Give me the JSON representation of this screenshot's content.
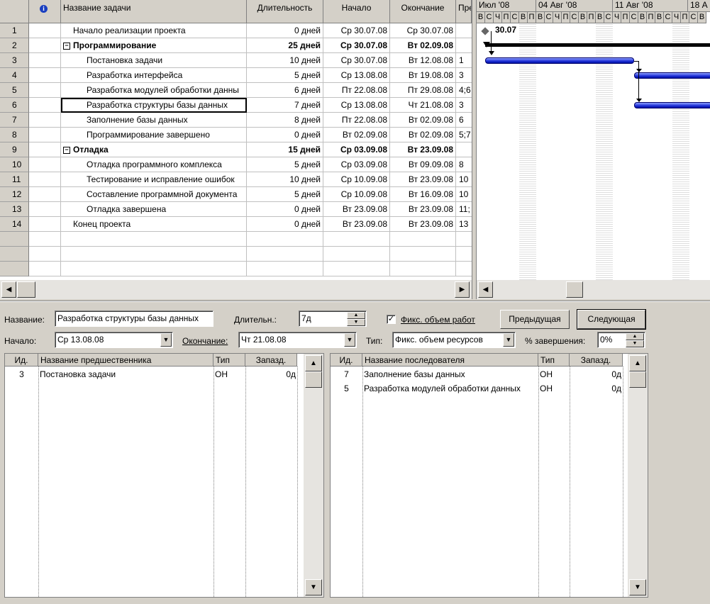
{
  "columns": {
    "info": "i",
    "name": "Название задачи",
    "duration": "Длительность",
    "start": "Начало",
    "finish": "Окончание",
    "pred": "Пре"
  },
  "tasks": [
    {
      "id": "1",
      "name": "Начало реализации проекта",
      "duration": "0 дней",
      "start": "Ср 30.07.08",
      "finish": "Ср 30.07.08",
      "pred": ""
    },
    {
      "id": "2",
      "name": "Программирование",
      "duration": "25 дней",
      "start": "Ср 30.07.08",
      "finish": "Вт 02.09.08",
      "pred": ""
    },
    {
      "id": "3",
      "name": "Постановка задачи",
      "duration": "10 дней",
      "start": "Ср 30.07.08",
      "finish": "Вт 12.08.08",
      "pred": "1"
    },
    {
      "id": "4",
      "name": "Разработка интерфейса",
      "duration": "5 дней",
      "start": "Ср 13.08.08",
      "finish": "Вт 19.08.08",
      "pred": "3"
    },
    {
      "id": "5",
      "name": "Разработка модулей обработки данны",
      "duration": "6 дней",
      "start": "Пт 22.08.08",
      "finish": "Пт 29.08.08",
      "pred": "4;6"
    },
    {
      "id": "6",
      "name": "Разработка структуры базы данных",
      "duration": "7 дней",
      "start": "Ср 13.08.08",
      "finish": "Чт 21.08.08",
      "pred": "3"
    },
    {
      "id": "7",
      "name": "Заполнение базы данных",
      "duration": "8 дней",
      "start": "Пт 22.08.08",
      "finish": "Вт 02.09.08",
      "pred": "6"
    },
    {
      "id": "8",
      "name": "Программирование завершено",
      "duration": "0 дней",
      "start": "Вт 02.09.08",
      "finish": "Вт 02.09.08",
      "pred": "5;7"
    },
    {
      "id": "9",
      "name": "Отладка",
      "duration": "15 дней",
      "start": "Ср 03.09.08",
      "finish": "Вт 23.09.08",
      "pred": ""
    },
    {
      "id": "10",
      "name": "Отладка программного комплекса",
      "duration": "5 дней",
      "start": "Ср 03.09.08",
      "finish": "Вт 09.09.08",
      "pred": "8"
    },
    {
      "id": "11",
      "name": "Тестирование и исправление ошибок",
      "duration": "10 дней",
      "start": "Ср 10.09.08",
      "finish": "Вт 23.09.08",
      "pred": "10"
    },
    {
      "id": "12",
      "name": "Составление программной документа",
      "duration": "5 дней",
      "start": "Ср 10.09.08",
      "finish": "Вт 16.09.08",
      "pred": "10"
    },
    {
      "id": "13",
      "name": "Отладка завершена",
      "duration": "0 дней",
      "start": "Вт 23.09.08",
      "finish": "Вт 23.09.08",
      "pred": "11;"
    },
    {
      "id": "14",
      "name": "Конец проекта",
      "duration": "0 дней",
      "start": "Вт 23.09.08",
      "finish": "Вт 23.09.08",
      "pred": "13"
    }
  ],
  "gantt": {
    "weeks": [
      "Июл '08",
      "04 Авг '08",
      "11 Авг '08",
      "18 А"
    ],
    "days": [
      "В",
      "С",
      "Ч",
      "П",
      "С",
      "В",
      "П",
      "В",
      "С",
      "Ч",
      "П",
      "С",
      "В",
      "П",
      "В",
      "С",
      "Ч",
      "П",
      "С",
      "В",
      "П",
      "В",
      "С",
      "Ч",
      "П",
      "С",
      "В"
    ],
    "milestone_label": "30.07"
  },
  "form": {
    "name_label": "Название:",
    "name_value": "Разработка структуры базы данных",
    "duration_label": "Длительн.:",
    "duration_value": "7д",
    "fixed_work_label": "Фикс. объем работ",
    "prev_button": "Предыдущая",
    "next_button": "Следующая",
    "start_label": "Начало:",
    "start_value": "Ср 13.08.08",
    "finish_label": "Окончание:",
    "finish_value": "Чт 21.08.08",
    "type_label": "Тип:",
    "type_value": "Фикс. объем ресурсов",
    "complete_label": "% завершения:",
    "complete_value": "0%"
  },
  "predecessors": {
    "headers": {
      "id": "Ид.",
      "name": "Название предшественника",
      "type": "Тип",
      "lag": "Запазд."
    },
    "rows": [
      {
        "id": "3",
        "name": "Постановка задачи",
        "type": "ОН",
        "lag": "0д"
      }
    ]
  },
  "successors": {
    "headers": {
      "id": "Ид.",
      "name": "Название последователя",
      "type": "Тип",
      "lag": "Запазд."
    },
    "rows": [
      {
        "id": "7",
        "name": "Заполнение базы данных",
        "type": "ОН",
        "lag": "0д"
      },
      {
        "id": "5",
        "name": "Разработка модулей обработки данных",
        "type": "ОН",
        "lag": "0д"
      }
    ]
  }
}
